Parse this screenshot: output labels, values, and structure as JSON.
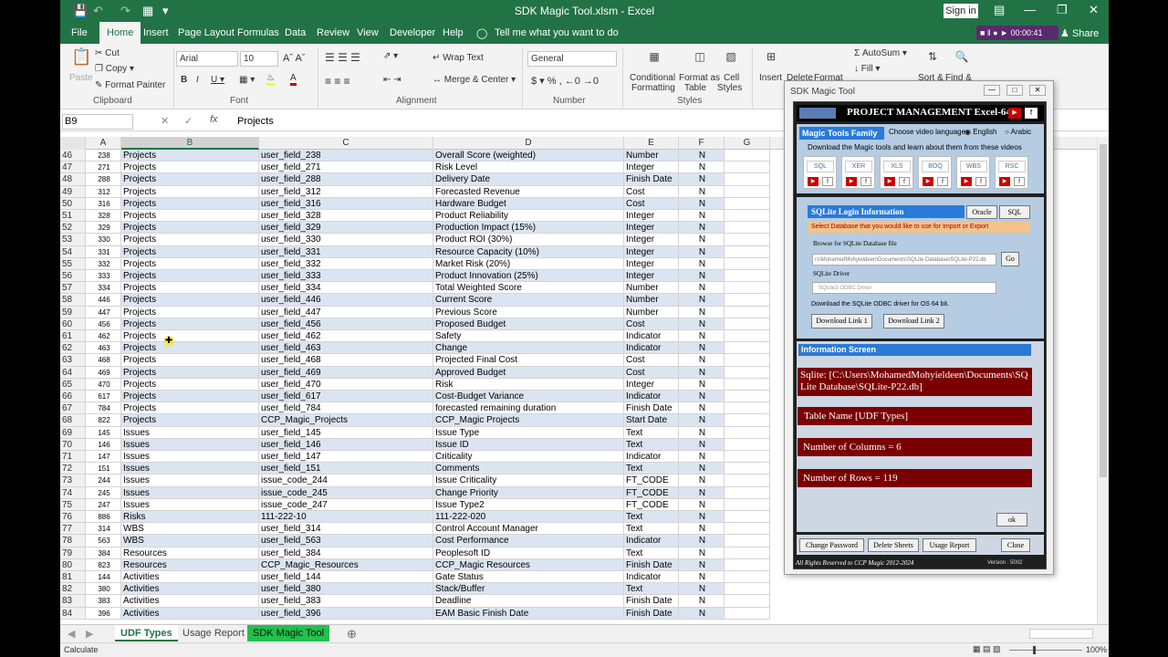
{
  "window": {
    "title": "SDK Magic Tool.xlsm  -  Excel",
    "signin": "Sign in"
  },
  "tabs": [
    "File",
    "Home",
    "Insert",
    "Page Layout",
    "Formulas",
    "Data",
    "Review",
    "View",
    "Developer",
    "Help"
  ],
  "tell_me": "Tell me what you want to do",
  "recorder": "00:00:41",
  "share": "Share",
  "ribbon": {
    "cut": "Cut",
    "copy": "Copy",
    "format_painter": "Format Painter",
    "paste": "Paste",
    "clipboard": "Clipboard",
    "font_name": "Arial",
    "font_size": "10",
    "font": "Font",
    "wrap_text": "Wrap Text",
    "merge_center": "Merge & Center",
    "alignment": "Alignment",
    "number_format": "General",
    "number": "Number",
    "cond_fmt": "Conditional",
    "cond_fmt2": "Formatting",
    "fmt_table": "Format as",
    "fmt_table2": "Table",
    "cell_styles": "Cell",
    "cell_styles2": "Styles",
    "styles": "Styles",
    "insert": "Insert",
    "delete": "Delete",
    "format": "Format",
    "autosum": "AutoSum",
    "fill": "Fill",
    "sort": "Sort &",
    "find": "Find &"
  },
  "formula": {
    "name_box": "B9",
    "fx": "fx",
    "value": "Projects"
  },
  "columns": [
    "A",
    "B",
    "C",
    "D",
    "E",
    "F",
    "G"
  ],
  "rows": [
    {
      "r": "46",
      "a": "238",
      "b": "Projects",
      "c": "user_field_238",
      "d": "Overall Score  (weighted)",
      "e": "Number",
      "f": "N"
    },
    {
      "r": "47",
      "a": "271",
      "b": "Projects",
      "c": "user_field_271",
      "d": "Risk Level",
      "e": "Integer",
      "f": "N"
    },
    {
      "r": "48",
      "a": "288",
      "b": "Projects",
      "c": "user_field_288",
      "d": "Delivery Date",
      "e": "Finish Date",
      "f": "N"
    },
    {
      "r": "49",
      "a": "312",
      "b": "Projects",
      "c": "user_field_312",
      "d": "Forecasted Revenue",
      "e": "Cost",
      "f": "N"
    },
    {
      "r": "50",
      "a": "316",
      "b": "Projects",
      "c": "user_field_316",
      "d": "Hardware Budget",
      "e": "Cost",
      "f": "N"
    },
    {
      "r": "51",
      "a": "328",
      "b": "Projects",
      "c": "user_field_328",
      "d": "Product Reliability",
      "e": "Integer",
      "f": "N"
    },
    {
      "r": "52",
      "a": "329",
      "b": "Projects",
      "c": "user_field_329",
      "d": "Production Impact  (15%)",
      "e": "Integer",
      "f": "N"
    },
    {
      "r": "53",
      "a": "330",
      "b": "Projects",
      "c": "user_field_330",
      "d": "Product ROI  (30%)",
      "e": "Integer",
      "f": "N"
    },
    {
      "r": "54",
      "a": "331",
      "b": "Projects",
      "c": "user_field_331",
      "d": "Resource Capacity  (10%)",
      "e": "Integer",
      "f": "N"
    },
    {
      "r": "55",
      "a": "332",
      "b": "Projects",
      "c": "user_field_332",
      "d": "Market Risk  (20%)",
      "e": "Integer",
      "f": "N"
    },
    {
      "r": "56",
      "a": "333",
      "b": "Projects",
      "c": "user_field_333",
      "d": "Product Innovation  (25%)",
      "e": "Integer",
      "f": "N"
    },
    {
      "r": "57",
      "a": "334",
      "b": "Projects",
      "c": "user_field_334",
      "d": "Total Weighted Score",
      "e": "Number",
      "f": "N"
    },
    {
      "r": "58",
      "a": "446",
      "b": "Projects",
      "c": "user_field_446",
      "d": "Current Score",
      "e": "Number",
      "f": "N"
    },
    {
      "r": "59",
      "a": "447",
      "b": "Projects",
      "c": "user_field_447",
      "d": "Previous Score",
      "e": "Number",
      "f": "N"
    },
    {
      "r": "60",
      "a": "456",
      "b": "Projects",
      "c": "user_field_456",
      "d": "Proposed Budget",
      "e": "Cost",
      "f": "N"
    },
    {
      "r": "61",
      "a": "462",
      "b": "Projects",
      "c": "user_field_462",
      "d": "Safety",
      "e": "Indicator",
      "f": "N"
    },
    {
      "r": "62",
      "a": "463",
      "b": "Projects",
      "c": "user_field_463",
      "d": "Change",
      "e": "Indicator",
      "f": "N"
    },
    {
      "r": "63",
      "a": "468",
      "b": "Projects",
      "c": "user_field_468",
      "d": "Projected Final Cost",
      "e": "Cost",
      "f": "N"
    },
    {
      "r": "64",
      "a": "469",
      "b": "Projects",
      "c": "user_field_469",
      "d": "Approved Budget",
      "e": "Cost",
      "f": "N"
    },
    {
      "r": "65",
      "a": "470",
      "b": "Projects",
      "c": "user_field_470",
      "d": "Risk",
      "e": "Integer",
      "f": "N"
    },
    {
      "r": "66",
      "a": "617",
      "b": "Projects",
      "c": "user_field_617",
      "d": "Cost-Budget Variance",
      "e": "Indicator",
      "f": "N"
    },
    {
      "r": "67",
      "a": "784",
      "b": "Projects",
      "c": "user_field_784",
      "d": "forecasted remaining duration",
      "e": "Finish Date",
      "f": "N"
    },
    {
      "r": "68",
      "a": "822",
      "b": "Projects",
      "c": "CCP_Magic_Projects",
      "d": "CCP_Magic Projects",
      "e": "Start Date",
      "f": "N"
    },
    {
      "r": "69",
      "a": "145",
      "b": "Issues",
      "c": "user_field_145",
      "d": "Issue Type",
      "e": "Text",
      "f": "N"
    },
    {
      "r": "70",
      "a": "146",
      "b": "Issues",
      "c": "user_field_146",
      "d": "Issue ID",
      "e": "Text",
      "f": "N"
    },
    {
      "r": "71",
      "a": "147",
      "b": "Issues",
      "c": "user_field_147",
      "d": "Criticality",
      "e": "Indicator",
      "f": "N"
    },
    {
      "r": "72",
      "a": "151",
      "b": "Issues",
      "c": "user_field_151",
      "d": "Comments",
      "e": "Text",
      "f": "N"
    },
    {
      "r": "73",
      "a": "244",
      "b": "Issues",
      "c": "issue_code_244",
      "d": "Issue Criticality",
      "e": "FT_CODE",
      "f": "N"
    },
    {
      "r": "74",
      "a": "245",
      "b": "Issues",
      "c": "issue_code_245",
      "d": "Change Priority",
      "e": "FT_CODE",
      "f": "N"
    },
    {
      "r": "75",
      "a": "247",
      "b": "Issues",
      "c": "issue_code_247",
      "d": "Issue Type2",
      "e": "FT_CODE",
      "f": "N"
    },
    {
      "r": "76",
      "a": "886",
      "b": "Risks",
      "c": "111-222-10",
      "d": "111-222-020",
      "e": "Text",
      "f": "N"
    },
    {
      "r": "77",
      "a": "314",
      "b": "WBS",
      "c": "user_field_314",
      "d": "Control Account Manager",
      "e": "Text",
      "f": "N"
    },
    {
      "r": "78",
      "a": "563",
      "b": "WBS",
      "c": "user_field_563",
      "d": "Cost Performance",
      "e": "Indicator",
      "f": "N"
    },
    {
      "r": "79",
      "a": "384",
      "b": "Resources",
      "c": "user_field_384",
      "d": "Peoplesoft ID",
      "e": "Text",
      "f": "N"
    },
    {
      "r": "80",
      "a": "823",
      "b": "Resources",
      "c": "CCP_Magic_Resources",
      "d": "CCP_Magic Resources",
      "e": "Finish Date",
      "f": "N"
    },
    {
      "r": "81",
      "a": "144",
      "b": "Activities",
      "c": "user_field_144",
      "d": "Gate Status",
      "e": "Indicator",
      "f": "N"
    },
    {
      "r": "82",
      "a": "380",
      "b": "Activities",
      "c": "user_field_380",
      "d": "Stack/Buffer",
      "e": "Text",
      "f": "N"
    },
    {
      "r": "83",
      "a": "383",
      "b": "Activities",
      "c": "user_field_383",
      "d": "Deadline",
      "e": "Finish Date",
      "f": "N"
    },
    {
      "r": "84",
      "a": "396",
      "b": "Activities",
      "c": "user_field_396",
      "d": "EAM Basic Finish Date",
      "e": "Finish Date",
      "f": "N"
    }
  ],
  "sheets": [
    "UDF Types",
    "Usage Report",
    "SDK Magic Tool"
  ],
  "status": {
    "mode": "Calculate",
    "zoom": "100%"
  },
  "dialog": {
    "title": "SDK Magic Tool",
    "header": "PROJECT MANAGEMENT Excel-64",
    "family_label": "Magic Tools Family",
    "choose_lang": "Choose video language",
    "english": "English",
    "arabic": "Arabic",
    "download_text": "Download the Magic tools and learn about them from these videos",
    "tools": [
      "SQL",
      "XER",
      "XLS",
      "BOQ",
      "WBS",
      "RSC"
    ],
    "sqlite_label": "SQLite Login Information",
    "oracle": "Oracle",
    "sql": "SQL",
    "select_db": "Select Database that you would like to use for Import or Export",
    "browse_label": "Browse for SQLite Database file",
    "db_path": "rs\\MohamedMohyieldeen\\Documents\\SQLite Database\\SQLite-P22.db",
    "go": "Go",
    "driver_label": "SQLite Driver",
    "driver_value": "SQLite3 ODBC Driver",
    "odbc_text": "Download the SQLite ODBC driver for OS 64 bit.",
    "link1": "Download Link 1",
    "link2": "Download Link 2",
    "info_label": "Information Screen",
    "info1": "Sqlite: [C:\\Users\\MohamedMohyieldeen\\Documents\\SQLite Database\\SQLite-P22.db]",
    "info2": "Table Name [UDF Types]",
    "info3": "Number of Columns = 6",
    "info4": "Number of Rows = 119",
    "ok": "ok",
    "change_password": "Change Password",
    "delete_sheets": "Delete Sheets",
    "usage_report": "Usage Report",
    "close": "Close",
    "rights": "All Rights Reserved to CCP Magic 2012-2024",
    "version": "Version : 5002"
  }
}
